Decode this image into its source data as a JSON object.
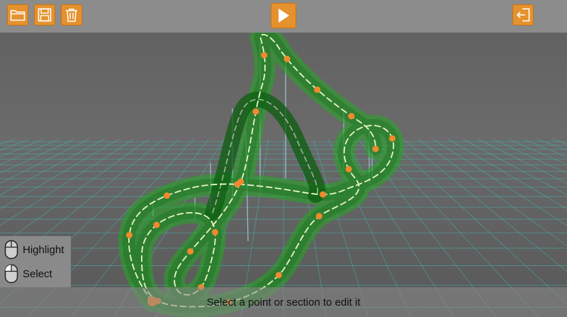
{
  "toolbar": {
    "buttons": [
      {
        "name": "open-folder-button",
        "icon": "folder-icon"
      },
      {
        "name": "save-button",
        "icon": "floppy-disk-icon"
      },
      {
        "name": "delete-button",
        "icon": "trash-icon"
      },
      {
        "name": "play-button",
        "icon": "play-icon"
      },
      {
        "name": "exit-button",
        "icon": "exit-icon"
      }
    ],
    "accent_color": "#e5912d"
  },
  "legend": {
    "highlight_label": "Highlight",
    "select_label": "Select",
    "highlight_icon": "mouse-move-icon",
    "select_icon": "mouse-left-click-icon"
  },
  "status": {
    "message": "Select a point or section to edit it"
  },
  "scene": {
    "track_color": "#2fb82f",
    "control_point_color": "#f08a2c",
    "grid_color": "#3fc7c0"
  }
}
